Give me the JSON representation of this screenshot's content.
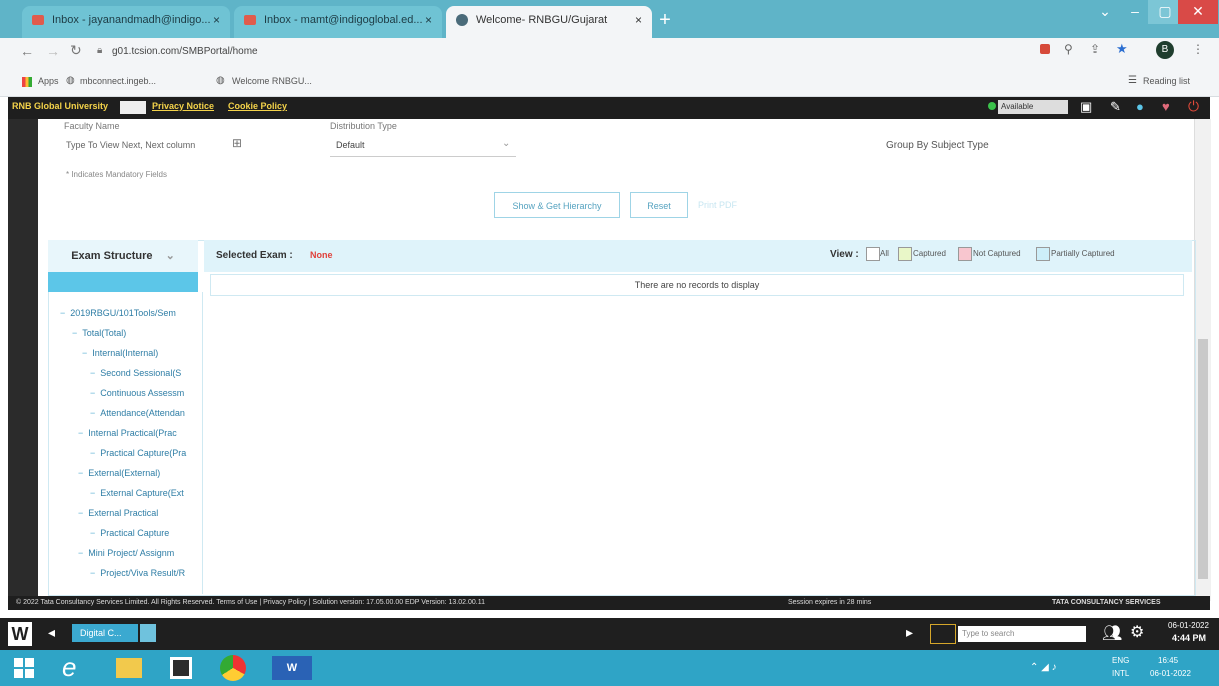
{
  "browser": {
    "tabs": [
      {
        "label": "Inbox - jayanandmadh@indigo...",
        "active": false
      },
      {
        "label": "Inbox - mamt@indigoglobal.ed...",
        "active": false
      },
      {
        "label": "Welcome- RNBGU/Gujarat",
        "active": true
      }
    ],
    "new_tab": "+",
    "url": "g01.tcsion.com/SMBPortal/home",
    "bookmarks": [
      "Apps",
      "mbconnect.ingeb...",
      "Welcome RNBGU..."
    ],
    "reading_list": "Reading list",
    "profile_initial": "B"
  },
  "app": {
    "brand": "RNB Global University",
    "links": [
      "Privacy Notice",
      "Cookie Policy"
    ],
    "status_select": "Available",
    "filters": {
      "faculty_label": "Faculty Name",
      "faculty_placeholder": "Type To View Next, Next column",
      "distribution_label": "Distribution Type",
      "distribution_value": "Default",
      "group_by": "Group By Subject Type",
      "mandatory_note": "* Indicates Mandatory Fields"
    },
    "buttons": {
      "primary": "Show & Get Hierarchy",
      "reset": "Reset",
      "third": "Print PDF"
    },
    "exam_structure_title": "Exam Structure",
    "exam_structure_chevron": "⌄",
    "selected_exam_label": "Selected Exam :",
    "selected_exam_value": "None",
    "view_label": "View :",
    "legend": [
      {
        "label": "All",
        "color": "#ffffff"
      },
      {
        "label": "Captured",
        "color": "#e9f7c8"
      },
      {
        "label": "Not Captured",
        "color": "#f8c6cf"
      },
      {
        "label": "Partially Captured",
        "color": "#cdeef9"
      }
    ],
    "no_records": "There are no records to display",
    "tree": [
      {
        "label": "2019RBGU/101Tools/Sem",
        "level": 0
      },
      {
        "label": "Total(Total)",
        "level": 1
      },
      {
        "label": "Internal(Internal)",
        "level": 2
      },
      {
        "label": "Second Sessional(S",
        "level": 3
      },
      {
        "label": "Continuous Assessm",
        "level": 3
      },
      {
        "label": "Attendance(Attendan",
        "level": 3
      },
      {
        "label": "Internal Practical(Prac",
        "level": 2
      },
      {
        "label": "Practical Capture(Pra",
        "level": 3
      },
      {
        "label": "External(External)",
        "level": 2
      },
      {
        "label": "External Capture(Ext",
        "level": 3
      },
      {
        "label": "External Practical",
        "level": 2
      },
      {
        "label": "Practical Capture",
        "level": 3
      },
      {
        "label": "Mini Project/ Assignm",
        "level": 2
      },
      {
        "label": "Project/Viva Result/R",
        "level": 3
      }
    ],
    "footer_left": "© 2022 Tata Consultancy Services Limited. All Rights Reserved.  Terms of Use | Privacy Policy | Solution version: 17.05.00.00  EDP Version: 13.02.00.11",
    "footer_mid": "Session expires in 28 mins",
    "footer_right": "TATA CONSULTANCY SERVICES"
  },
  "taskbar": {
    "app_tab": "Digital C...",
    "search_placeholder": "Type to search",
    "time": "4:44 PM",
    "date": "06-01-2022",
    "lang": "ENG",
    "lang_sub": "INTL",
    "time2": "16:45",
    "date2": "06-01-2022"
  },
  "colors": {
    "tabstrip": "#5fb4c8",
    "accent_blue": "#5cc6e8",
    "header_yellow": "#f4d34a",
    "red": "#e0403a"
  }
}
